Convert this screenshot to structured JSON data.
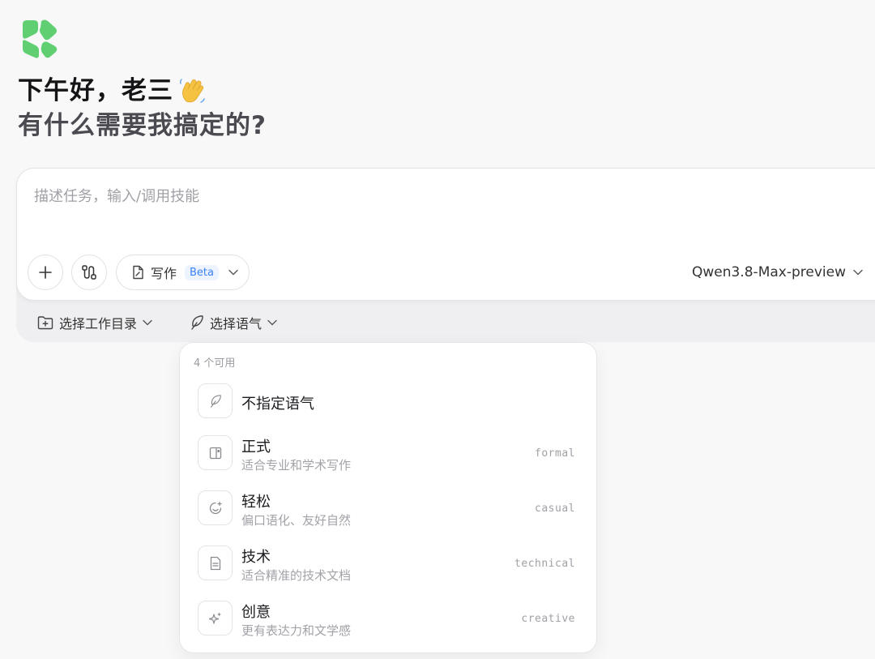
{
  "greeting": {
    "line1": "下午好，老三",
    "line2": "有什么需要我搞定的?"
  },
  "composer": {
    "placeholder": "描述任务，输入/调用技能",
    "write_label": "写作",
    "beta_badge": "Beta",
    "model": "Qwen3.8-Max-preview"
  },
  "options": {
    "workdir_label": "选择工作目录",
    "tone_label": "选择语气"
  },
  "dropdown": {
    "count_label": "4 个可用",
    "items": [
      {
        "title": "不指定语气",
        "subtitle": "",
        "key": "",
        "icon": "feather-icon"
      },
      {
        "title": "正式",
        "subtitle": "适合专业和学术写作",
        "key": "formal",
        "icon": "layout-icon"
      },
      {
        "title": "轻松",
        "subtitle": "偏口语化、友好自然",
        "key": "casual",
        "icon": "smile-icon"
      },
      {
        "title": "技术",
        "subtitle": "适合精准的技术文档",
        "key": "technical",
        "icon": "document-icon"
      },
      {
        "title": "创意",
        "subtitle": "更有表达力和文学感",
        "key": "creative",
        "icon": "sparkle-icon"
      }
    ]
  },
  "colors": {
    "logo_green": "#5fcf72",
    "beta_blue": "#3b82f6"
  }
}
